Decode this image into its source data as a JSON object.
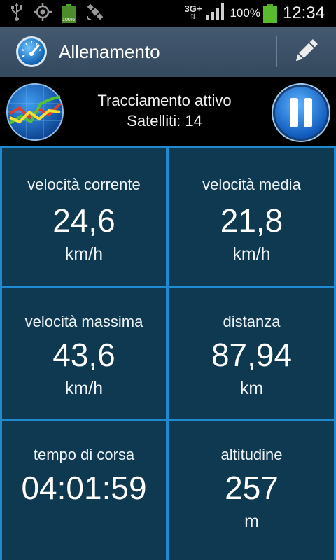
{
  "status_bar": {
    "network": "3G+",
    "battery_percent": "100%",
    "time": "12:34",
    "small_battery_label": "100%",
    "icons": [
      "usb-icon",
      "gps-target-icon",
      "battery-small-icon",
      "satellite-icon",
      "signal-icon",
      "battery-icon"
    ]
  },
  "action_bar": {
    "title": "Allenamento",
    "app_icon": "speedometer-icon",
    "action_icon": "pencil-icon"
  },
  "tracking": {
    "status": "Tracciamento attivo",
    "satellites": "Satelliti: 14",
    "left_icon": "chart-globe-icon",
    "right_icon": "pause-icon"
  },
  "stats": [
    {
      "label": "velocità corrente",
      "value": "24,6",
      "unit": "km/h"
    },
    {
      "label": "velocità media",
      "value": "21,8",
      "unit": "km/h"
    },
    {
      "label": "velocità massima",
      "value": "43,6",
      "unit": "km/h"
    },
    {
      "label": "distanza",
      "value": "87,94",
      "unit": "km"
    },
    {
      "label": "tempo di corsa",
      "value": "04:01:59",
      "unit": ""
    },
    {
      "label": "altitudine",
      "value": "257",
      "unit": "m"
    }
  ],
  "colors": {
    "grid_border": "#1f8ad0",
    "cell_bg": "#0f3951",
    "action_bar": "#3c5169"
  }
}
